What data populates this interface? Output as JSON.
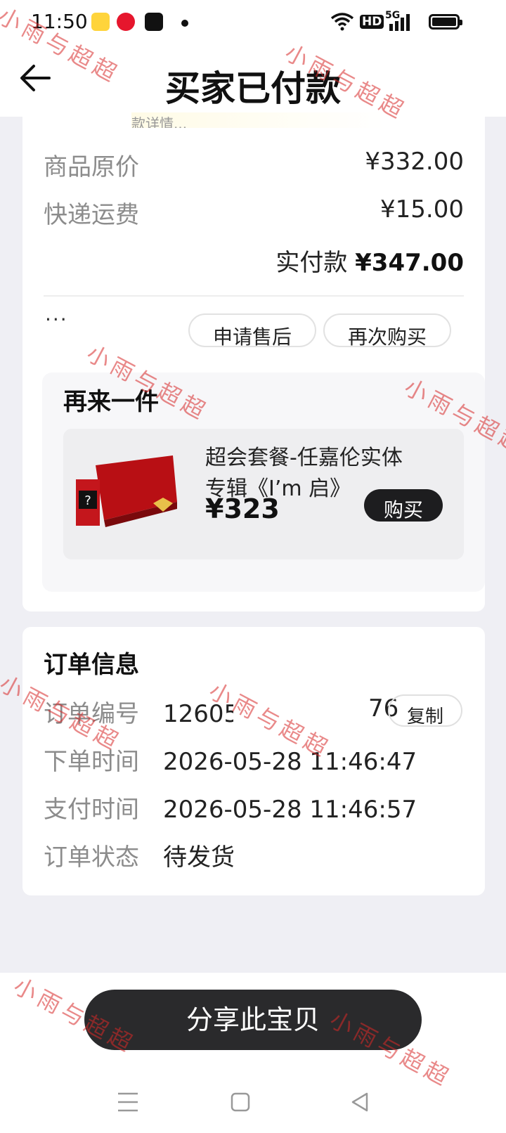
{
  "status_bar": {
    "time": "11:50",
    "hd": "HD",
    "net": "5G"
  },
  "header": {
    "title": "买家已付款"
  },
  "price": {
    "peek_text": "款详情...",
    "original_label": "商品原价",
    "original_value": "¥332.00",
    "shipping_label": "快递运费",
    "shipping_value": "¥15.00",
    "paid_label": "实付款",
    "paid_value": "¥347.00"
  },
  "actions": {
    "more": "···",
    "after_sale": "申请售后",
    "buy_again": "再次购买"
  },
  "again": {
    "title": "再来一件",
    "product_name": "超会套餐-任嘉伦实体专辑《I’m 启》",
    "product_price": "¥323",
    "buy": "购买"
  },
  "order_info": {
    "title": "订单信息",
    "number_label": "订单编号",
    "number_value": "12605",
    "number_tail": "76",
    "copy": "复制",
    "order_time_label": "下单时间",
    "order_time_value": "2026-05-28 11:46:47",
    "pay_time_label": "支付时间",
    "pay_time_value": "2026-05-28 11:46:57",
    "status_label": "订单状态",
    "status_value": "待发货"
  },
  "bottom": {
    "share": "分享此宝贝"
  },
  "watermark": "小雨与超超",
  "colors": {
    "accent_dark": "#1d1d1f",
    "watermark": "#d72828",
    "label_gray": "#8c8c8c"
  }
}
